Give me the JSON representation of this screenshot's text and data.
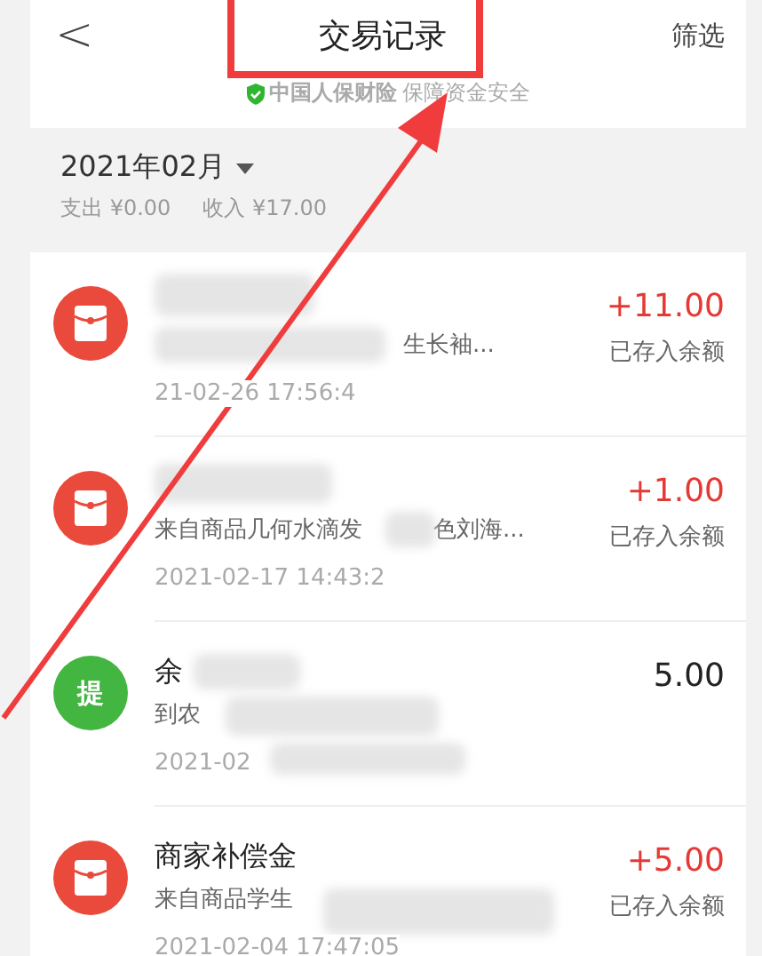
{
  "header": {
    "back": "<",
    "title": "交易记录",
    "filter": "筛选",
    "notice": {
      "brand": "中国人保财险",
      "text": "保障资金安全"
    }
  },
  "month": {
    "label": "2021年02月",
    "spend": "支出 ¥0.00",
    "income": "收入 ¥17.00"
  },
  "transactions": [
    {
      "desc": [
        "生长袖..."
      ],
      "date": "21-02-26 17:56:4",
      "amount": "+11.00",
      "kind": "income",
      "status": "已存入余额"
    },
    {
      "desc": [
        "来自商品几何水滴发",
        "色刘海..."
      ],
      "date": "2021-02-17 14:43:2",
      "amount": "+1.00",
      "kind": "income",
      "status": "已存入余额"
    },
    {
      "badge": "提",
      "title": "余",
      "desc": [
        "到农"
      ],
      "date": "2021-02",
      "amount": "5.00",
      "kind": "withdraw"
    },
    {
      "title": "商家补偿金",
      "desc": [
        "来自商品学生"
      ],
      "date": "2021-02-04 17:47:05",
      "amount": "+5.00",
      "kind": "income",
      "status": "已存入余额"
    }
  ]
}
